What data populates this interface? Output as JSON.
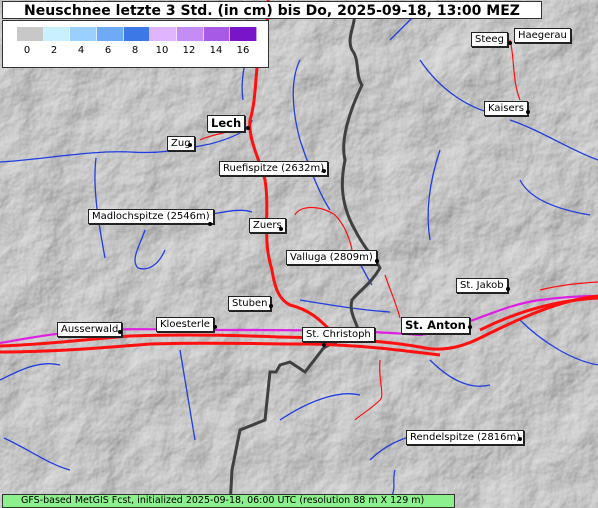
{
  "title": "Neuschnee letzte 3 Std. (in cm) bis Do, 2025-09-18, 13:00 MEZ",
  "legend": {
    "colors": [
      "#c8c8c8",
      "#c8f0ff",
      "#9ad0ff",
      "#6eaaf6",
      "#3c78e6",
      "#e0b4ff",
      "#c58cf5",
      "#a65ae6",
      "#7a14c8"
    ],
    "ticks": [
      "0",
      "2",
      "4",
      "6",
      "8",
      "10",
      "12",
      "14",
      "16"
    ]
  },
  "places": {
    "lech": "Lech",
    "zug": "Zug",
    "ruefispitze": "Ruefispitze (2632m)",
    "madlochspitze": "Madlochspitze (2546m)",
    "zuers": "Zuers",
    "valluga": "Valluga (2809m)",
    "stuben": "Stuben",
    "kloesterle": "Kloesterle",
    "ausserwald": "Ausserwald",
    "st_christoph": "St. Christoph",
    "st_anton": "St. Anton",
    "st_jakob": "St. Jakob",
    "kaisers": "Kaisers",
    "steeg": "Steeg",
    "haegerau": "Haegerau",
    "rendelspitze": "Rendelspitze (2816m)"
  },
  "footer": "GFS-based MetGIS Fcst, initialized 2025-09-18, 06:00 UTC  (resolution 88 m X 129 m)"
}
